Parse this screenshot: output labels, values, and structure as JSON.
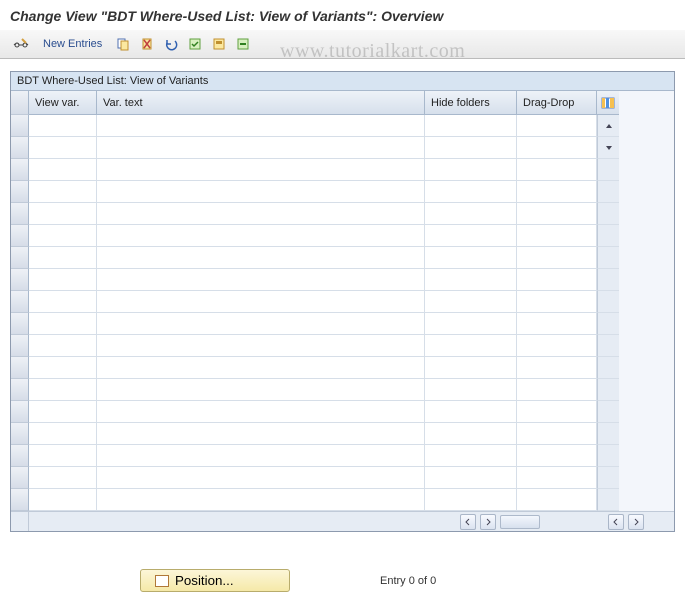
{
  "title": "Change View \"BDT Where-Used List: View of Variants\": Overview",
  "watermark": "www.tutorialkart.com",
  "toolbar": {
    "new_entries_label": "New Entries"
  },
  "table": {
    "title": "BDT Where-Used List: View of Variants",
    "columns": {
      "view_var": "View var.",
      "var_text": "Var. text",
      "hide_folders": "Hide folders",
      "drag_drop": "Drag-Drop"
    },
    "rows": [
      {},
      {},
      {},
      {},
      {},
      {},
      {},
      {},
      {},
      {},
      {},
      {},
      {},
      {},
      {},
      {},
      {},
      {}
    ]
  },
  "footer": {
    "position_label": "Position...",
    "entry_text": "Entry 0 of 0"
  }
}
